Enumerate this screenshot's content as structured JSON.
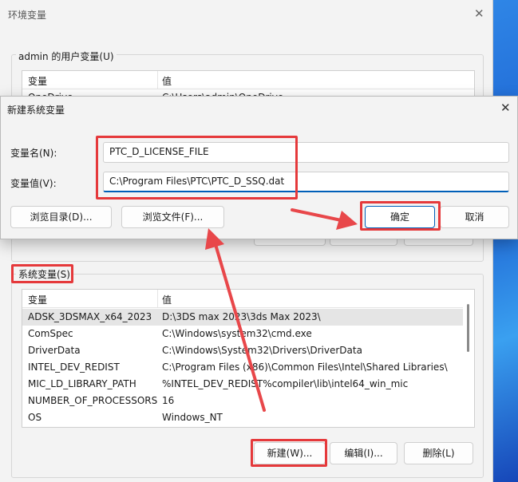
{
  "env_window": {
    "title": "环境变量",
    "close_glyph": "✕",
    "user_group_label": "admin 的用户变量(U)",
    "user_vars": {
      "columns": [
        "变量",
        "值"
      ],
      "partial_row": {
        "name": "OneDrive",
        "value": "C:\\Users\\admin\\OneDrive"
      }
    },
    "system_group_label": "系统变量(S)",
    "system_vars": {
      "columns": [
        "变量",
        "值"
      ],
      "rows": [
        {
          "name": "ADSK_3DSMAX_x64_2023",
          "value": "D:\\3DS max 2023\\3ds Max 2023\\"
        },
        {
          "name": "ComSpec",
          "value": "C:\\Windows\\system32\\cmd.exe"
        },
        {
          "name": "DriverData",
          "value": "C:\\Windows\\System32\\Drivers\\DriverData"
        },
        {
          "name": "INTEL_DEV_REDIST",
          "value": "C:\\Program Files (x86)\\Common Files\\Intel\\Shared Libraries\\"
        },
        {
          "name": "MIC_LD_LIBRARY_PATH",
          "value": "%INTEL_DEV_REDIST%compiler\\lib\\intel64_win_mic"
        },
        {
          "name": "NUMBER_OF_PROCESSORS",
          "value": "16"
        },
        {
          "name": "OS",
          "value": "Windows_NT"
        }
      ]
    },
    "buttons": {
      "new": "新建(W)...",
      "edit": "编辑(I)...",
      "delete": "删除(L)"
    }
  },
  "new_var_dialog": {
    "title": "新建系统变量",
    "close_glyph": "✕",
    "name_label": "变量名(N):",
    "name_value": "PTC_D_LICENSE_FILE",
    "value_label": "变量值(V):",
    "value_value": "C:\\Program Files\\PTC\\PTC_D_SSQ.dat",
    "buttons": {
      "browse_dir": "浏览目录(D)...",
      "browse_file": "浏览文件(F)...",
      "ok": "确定",
      "cancel": "取消"
    }
  },
  "annotation_colors": {
    "highlight": "#e5393b",
    "arrow": "#e8474a"
  },
  "accent_color": "#005fb8"
}
